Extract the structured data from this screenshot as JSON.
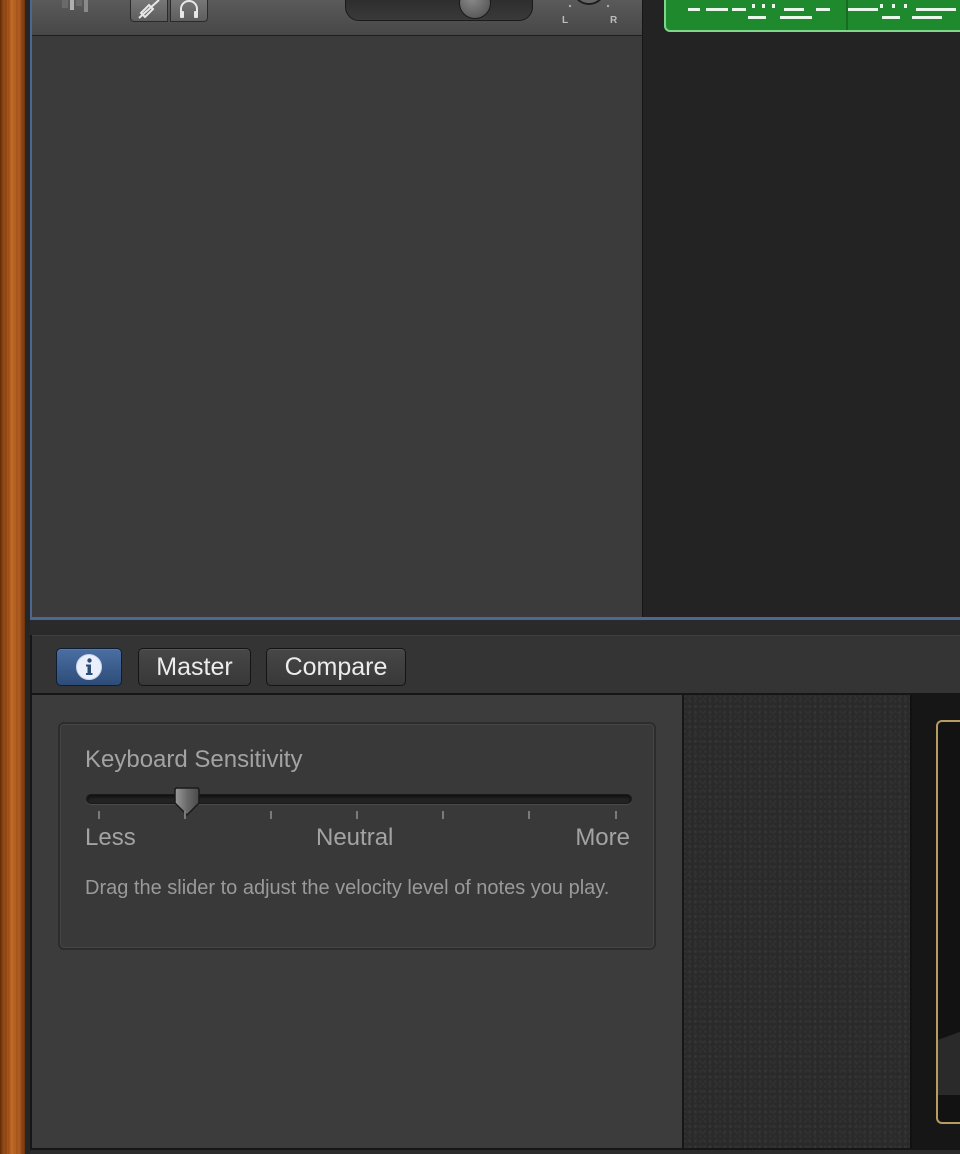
{
  "track_header": {
    "pan_left_label": "L",
    "pan_right_label": "R",
    "region_color": "#1e8a2d"
  },
  "toolbar": {
    "info_icon": "info-icon",
    "master_label": "Master",
    "compare_label": "Compare"
  },
  "smart_controls": {
    "title": "Keyboard Sensitivity",
    "slider_value_fraction": 0.185,
    "labels": {
      "less": "Less",
      "neutral": "Neutral",
      "more": "More"
    },
    "description": "Drag the slider to adjust the velocity level of notes you play."
  },
  "colors": {
    "accent_blue": "#4b6fa3",
    "keyboard_frame": "#b69b63",
    "wood": "#a95417"
  }
}
